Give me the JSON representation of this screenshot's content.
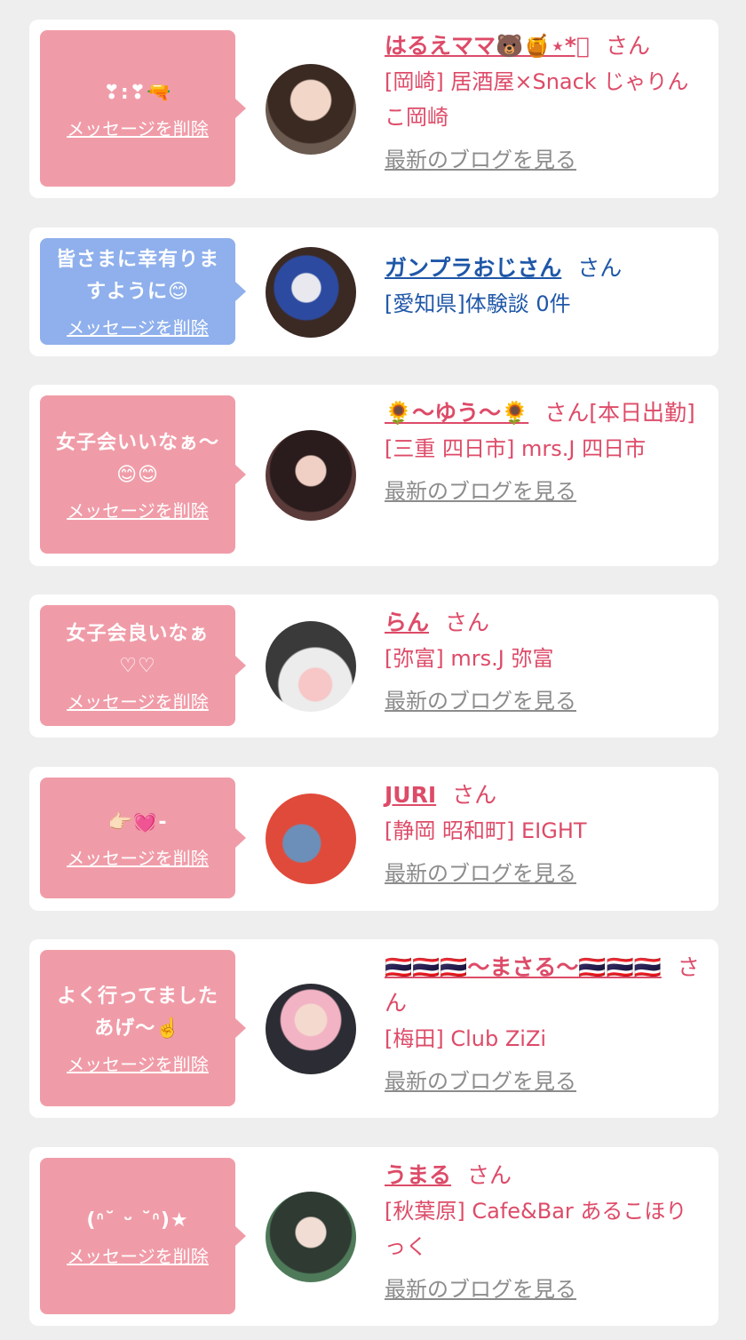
{
  "colors": {
    "pink_bubble": "#f09ca8",
    "blue_bubble": "#8fb0ec",
    "pink_text": "#dd4b68",
    "blue_text": "#1f57a8",
    "link_gray": "#8c8c8c"
  },
  "delete_label": "メッセージを削除",
  "blog_label": "最新のブログを見る",
  "cards": [
    {
      "message": "❣:❣🔫",
      "name": "はるえママ🐻🍯⋆*ﾟ",
      "san": "さん",
      "shop": "[岡崎] 居酒屋×Snack じゃりんこ岡崎",
      "has_blog": true,
      "theme": "pink"
    },
    {
      "message": "皆さまに幸有りますように😊",
      "name": "ガンプラおじさん",
      "san": "さん",
      "shop": "[愛知県]体験談 0件",
      "has_blog": false,
      "theme": "blue"
    },
    {
      "message": "女子会いいなぁ〜😊😊",
      "name": "🌻〜ゆう〜🌻",
      "san": "さん[本日出勤]",
      "shop": "[三重 四日市] mrs.J 四日市",
      "has_blog": true,
      "theme": "pink"
    },
    {
      "message": "女子会良いなぁ♡♡",
      "name": "らん",
      "san": "さん",
      "shop": "[弥富] mrs.J 弥富",
      "has_blog": true,
      "theme": "pink"
    },
    {
      "message": "👉🏻💓-",
      "name": "JURI",
      "san": "さん",
      "shop": "[静岡 昭和町] EIGHT",
      "has_blog": true,
      "theme": "pink"
    },
    {
      "message": "よく行ってましたあげ〜☝️",
      "name": "🇹🇭🇹🇭🇹🇭〜まさる〜🇹🇭🇹🇭🇹🇭",
      "san": "さん",
      "shop": "[梅田] Club ZiZi",
      "has_blog": true,
      "theme": "pink"
    },
    {
      "message": "(ᐢ˘ ᵕ ˘ᐢ)★",
      "name": "うまる",
      "san": "さん",
      "shop": "[秋葉原] Cafe&Bar あるこほりっく",
      "has_blog": true,
      "theme": "pink"
    }
  ]
}
